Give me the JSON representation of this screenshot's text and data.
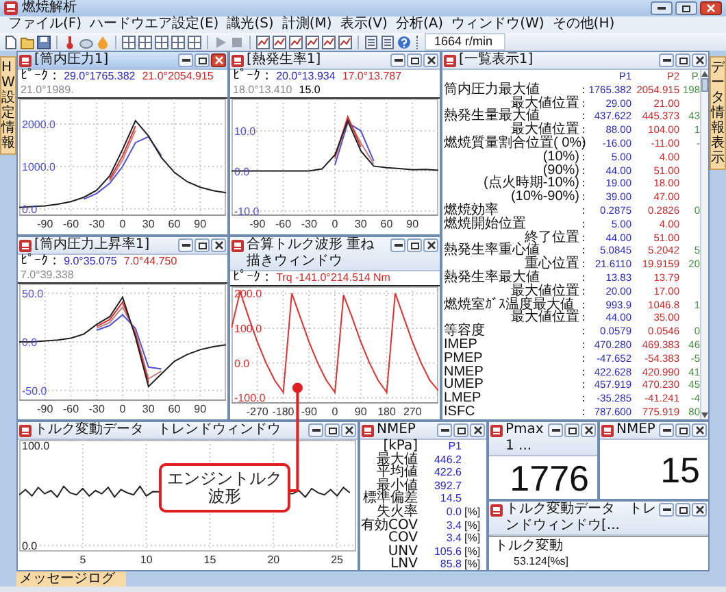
{
  "window": {
    "title": "燃焼解析"
  },
  "menu": [
    "ファイル(F)",
    "ハードウエア設定(E)",
    "識光(S)",
    "計測(M)",
    "表示(V)",
    "分析(A)",
    "ウィンドウ(W)",
    "その他(H)"
  ],
  "toolbar": {
    "rpm": "1664 r/min"
  },
  "side_tabs": {
    "left": "HW設定情報",
    "right": "データ情報表示"
  },
  "chart_windows": [
    {
      "title": "[筒内圧力1]",
      "active": true,
      "readout": {
        "label": "ﾋﾟｰｸ :",
        "values": [
          {
            "angle": "29.0°",
            "value": "1765.382",
            "color": "#2828c8"
          },
          {
            "angle": "21.0°",
            "value": "2054.915",
            "color": "#d02828"
          },
          {
            "angle": "21.0°",
            "value": "1989.",
            "color": "#8a8a8a"
          }
        ]
      },
      "chart_data": {
        "type": "line",
        "grid": true,
        "x": [
          -120,
          -105,
          -90,
          -75,
          -60,
          -45,
          -30,
          -15,
          0,
          15,
          30,
          45,
          60,
          75,
          90,
          105,
          120
        ],
        "xlim": [
          -120,
          120
        ],
        "ylim": [
          -150,
          2600
        ],
        "xticks": [
          -90,
          -60,
          -30,
          0,
          30,
          60,
          90
        ],
        "yticks": [
          {
            "value": 0,
            "label": "0.0"
          },
          {
            "value": 1000,
            "label": "1000.0"
          },
          {
            "value": 2000,
            "label": "2000.0"
          }
        ],
        "series": [
          {
            "color": "#5050d8",
            "values": [
              null,
              null,
              null,
              null,
              null,
              230,
              360,
              600,
              1000,
              1560,
              1700,
              1250,
              null,
              null,
              null,
              null,
              null
            ]
          },
          {
            "color": "#c08080",
            "values": [
              null,
              null,
              null,
              null,
              null,
              null,
              null,
              650,
              1150,
              1850,
              null,
              null,
              null,
              null,
              null,
              null,
              null
            ]
          },
          {
            "color": "#d83030",
            "values": [
              null,
              null,
              null,
              null,
              null,
              null,
              null,
              700,
              1250,
              1950,
              null,
              null,
              null,
              null,
              null,
              null,
              null
            ]
          },
          {
            "color": "#202020",
            "values": [
              30,
              50,
              70,
              110,
              170,
              270,
              440,
              780,
              1400,
              2080,
              1720,
              1210,
              860,
              640,
              510,
              430,
              380
            ]
          }
        ]
      }
    },
    {
      "title": "[熱発生率1]",
      "active": false,
      "readout": {
        "label": "ﾋﾟｰｸ :",
        "values": [
          {
            "angle": "20.0°",
            "value": "13.934",
            "color": "#2828c8"
          },
          {
            "angle": "17.0°",
            "value": "13.787",
            "color": "#d02828"
          },
          {
            "angle": "18.0°",
            "value": "13.410",
            "color": "#8a8a8a"
          },
          {
            "angle": "15.0",
            "color": "#000000"
          }
        ]
      },
      "chart_data": {
        "type": "line",
        "grid": true,
        "x": [
          -120,
          -105,
          -90,
          -75,
          -60,
          -45,
          -30,
          -15,
          0,
          15,
          30,
          45,
          60,
          75,
          90,
          105,
          120
        ],
        "xlim": [
          -120,
          120
        ],
        "ylim": [
          -11,
          18
        ],
        "xticks": [
          -90,
          -60,
          -30,
          0,
          30,
          60,
          90
        ],
        "yticks": [
          {
            "value": -10,
            "label": "-10.0"
          },
          {
            "value": 0,
            "label": "0.0"
          },
          {
            "value": 10,
            "label": "10.0"
          }
        ],
        "series": [
          {
            "color": "#5050d8",
            "values": [
              null,
              null,
              null,
              null,
              null,
              null,
              null,
              null,
              1.5,
              12,
              10,
              2.5,
              null,
              null,
              null,
              null,
              null
            ]
          },
          {
            "color": "#c08080",
            "values": [
              null,
              null,
              null,
              null,
              null,
              null,
              null,
              null,
              3,
              13,
              7,
              1.8,
              null,
              null,
              null,
              null,
              null
            ]
          },
          {
            "color": "#d83030",
            "values": [
              null,
              null,
              null,
              null,
              null,
              null,
              null,
              null,
              3.5,
              13.5,
              6,
              null,
              null,
              null,
              null,
              null,
              null
            ]
          },
          {
            "color": "#202020",
            "values": [
              0,
              0,
              0,
              0,
              0,
              0,
              0,
              0.5,
              4,
              12.5,
              5,
              1.2,
              0.8,
              0.6,
              0.3,
              0.4,
              0.2
            ]
          }
        ]
      }
    },
    {
      "title": "[筒内圧力上昇率1]",
      "active": false,
      "readout": {
        "label": "ﾋﾟｰｸ :",
        "values": [
          {
            "angle": "9.0°",
            "value": "35.075",
            "color": "#2828c8"
          },
          {
            "angle": "7.0°",
            "value": "44.750",
            "color": "#d02828"
          },
          {
            "angle": "7.0°",
            "value": "39.338",
            "color": "#8a8a8a"
          }
        ]
      },
      "chart_data": {
        "type": "line",
        "grid": true,
        "x": [
          -120,
          -105,
          -90,
          -75,
          -60,
          -45,
          -30,
          -15,
          0,
          15,
          30,
          45,
          60,
          75,
          90,
          105,
          120
        ],
        "xlim": [
          -120,
          120
        ],
        "ylim": [
          -60,
          60
        ],
        "xticks": [
          -90,
          -60,
          -30,
          0,
          30,
          60,
          90
        ],
        "yticks": [
          {
            "value": -50,
            "label": "-50.0"
          },
          {
            "value": 0,
            "label": "0.0"
          },
          {
            "value": 50,
            "label": "50.0"
          }
        ],
        "series": [
          {
            "color": "#5050d8",
            "values": [
              null,
              null,
              null,
              null,
              null,
              null,
              12,
              17,
              28,
              14,
              -26,
              -28,
              null,
              null,
              null,
              null,
              null
            ]
          },
          {
            "color": "#c08080",
            "values": [
              null,
              null,
              null,
              null,
              null,
              null,
              14,
              20,
              36,
              10,
              -38,
              -30,
              null,
              null,
              null,
              null,
              null
            ]
          },
          {
            "color": "#d83030",
            "values": [
              null,
              null,
              null,
              null,
              null,
              null,
              16,
              23,
              41,
              8,
              -42,
              null,
              null,
              null,
              null,
              null,
              null
            ]
          },
          {
            "color": "#202020",
            "values": [
              0,
              0,
              1,
              2,
              4,
              8,
              18,
              26,
              46,
              5,
              -46,
              -33,
              -20,
              -13,
              -8,
              -5,
              -3
            ]
          }
        ]
      }
    },
    {
      "title": "合算トルク波形 重ね描きウィンドウ",
      "active": false,
      "readout": {
        "label": "ﾋﾟｰｸ :",
        "values": [
          {
            "angle": "Trq -141.0°",
            "value": "214.514 Nm",
            "color": "#d02828"
          }
        ]
      },
      "chart_data": {
        "type": "line",
        "grid": true,
        "x": [
          -360,
          -330,
          -300,
          -270,
          -240,
          -210,
          -180,
          -150,
          -120,
          -90,
          -60,
          -30,
          0,
          30,
          60,
          90,
          120,
          150,
          180,
          210,
          240,
          270,
          300,
          330,
          360
        ],
        "xlim": [
          -360,
          360
        ],
        "ylim": [
          -115,
          220
        ],
        "xticks": [
          -270,
          -180,
          -90,
          0,
          90,
          180,
          270
        ],
        "yticks": [
          {
            "value": -100,
            "label": "-100.0"
          },
          {
            "value": 0,
            "label": "0.0"
          },
          {
            "value": 100,
            "label": "100.0"
          },
          {
            "value": 200,
            "label": "200.0"
          }
        ],
        "series": [
          {
            "color": "#e03030",
            "values": [
              100,
              205,
              130,
              60,
              0,
              -50,
              -85,
              200,
              130,
              60,
              0,
              -50,
              -85,
              195,
              130,
              60,
              0,
              -50,
              -85,
              200,
              130,
              60,
              0,
              -50,
              -80
            ]
          }
        ]
      }
    }
  ],
  "summary_window": {
    "title": "[一覧表示1]",
    "active": false,
    "columns": [
      {
        "label": "P1",
        "color": "#2828c8"
      },
      {
        "label": "P2",
        "color": "#d02828"
      },
      {
        "label": "P.",
        "color": "#409040"
      }
    ],
    "rows": [
      {
        "label": "筒内圧力最大値",
        "kind": "main",
        "sep": ":",
        "values": [
          "1765.382",
          "2054.915",
          "198"
        ]
      },
      {
        "label": "最大値位置",
        "kind": "sub",
        "sep": ":",
        "values": [
          "29.00",
          "21.00"
        ]
      },
      {
        "label": "熱発生量最大値",
        "kind": "main",
        "sep": ":",
        "values": [
          "437.622",
          "445.373",
          "43"
        ]
      },
      {
        "label": "最大値位置",
        "kind": "sub",
        "sep": ":",
        "values": [
          "88.00",
          "104.00",
          "1"
        ]
      },
      {
        "label": "燃焼質量割合位置( 0%)",
        "kind": "main",
        "sep": ":",
        "values": [
          "-16.00",
          "-11.00",
          "-"
        ]
      },
      {
        "label": "(10%)",
        "kind": "sub",
        "sep": ":",
        "values": [
          "5.00",
          "4.00"
        ]
      },
      {
        "label": "(90%)",
        "kind": "sub",
        "sep": ":",
        "values": [
          "44.00",
          "51.00"
        ]
      },
      {
        "label": "(点火時期-10%)",
        "kind": "sub",
        "sep": ":",
        "values": [
          "19.00",
          "18.00"
        ]
      },
      {
        "label": "(10%-90%)",
        "kind": "sub",
        "sep": ":",
        "values": [
          "39.00",
          "47.00"
        ]
      },
      {
        "label": "燃焼効率",
        "kind": "main",
        "sep": ":",
        "values": [
          "0.2875",
          "0.2826",
          "0"
        ]
      },
      {
        "label": "燃焼開始位置",
        "kind": "main",
        "sep": ":",
        "values": [
          "5.00",
          "4.00"
        ]
      },
      {
        "label": "終了位置",
        "kind": "sub",
        "sep": ":",
        "values": [
          "44.00",
          "51.00"
        ]
      },
      {
        "label": "熱発生率重心値",
        "kind": "main",
        "sep": ":",
        "values": [
          "5.0845",
          "5.2042",
          "5"
        ]
      },
      {
        "label": "重心位置",
        "kind": "sub",
        "sep": ":",
        "values": [
          "21.6110",
          "19.9159",
          "20"
        ]
      },
      {
        "label": "熱発生率最大値",
        "kind": "main",
        "sep": ":",
        "values": [
          "13.83",
          "13.79"
        ]
      },
      {
        "label": "最大値位置",
        "kind": "sub",
        "sep": ":",
        "values": [
          "20.00",
          "17.00"
        ]
      },
      {
        "label": "燃焼室ｶﾞｽ温度最大値",
        "kind": "main",
        "sep": ":",
        "values": [
          "993.9",
          "1046.8",
          "1"
        ]
      },
      {
        "label": "最大値位置",
        "kind": "sub",
        "sep": ":",
        "values": [
          "44.00",
          "35.00"
        ]
      },
      {
        "label": "等容度",
        "kind": "main",
        "sep": ":",
        "values": [
          "0.0579",
          "0.0546",
          "0"
        ]
      },
      {
        "label": "IMEP",
        "kind": "main",
        "sep": ":",
        "values": [
          "470.280",
          "469.383",
          "46"
        ]
      },
      {
        "label": "PMEP",
        "kind": "main",
        "sep": ":",
        "values": [
          "-47.652",
          "-54.383",
          "-5"
        ]
      },
      {
        "label": "NMEP",
        "kind": "main",
        "sep": ":",
        "values": [
          "422.628",
          "420.990",
          "41"
        ]
      },
      {
        "label": "UMEP",
        "kind": "main",
        "sep": ":",
        "values": [
          "457.919",
          "470.230",
          "45"
        ]
      },
      {
        "label": "LMEP",
        "kind": "main",
        "sep": ":",
        "values": [
          "-35.285",
          "-41.241",
          "-4"
        ]
      },
      {
        "label": "ISFC",
        "kind": "main",
        "sep": ":",
        "values": [
          "787.600",
          "775.919",
          "80"
        ]
      }
    ]
  },
  "trend_window": {
    "title": "トルク変動データ　トレンドウィンドウ",
    "active": false,
    "chart_data": {
      "type": "line",
      "grid": true,
      "x": [
        0,
        0.5,
        1,
        1.5,
        2,
        2.5,
        3,
        3.5,
        4,
        4.5,
        5,
        5.5,
        6,
        6.5,
        7,
        7.5,
        8,
        8.5,
        9,
        9.5,
        10,
        10.5,
        21.5,
        22,
        22.5,
        23,
        23.5,
        24,
        24.5,
        25,
        25.5,
        26
      ],
      "xlim": [
        0,
        26.5
      ],
      "ylim": [
        -5,
        100
      ],
      "xticks": [
        5,
        10,
        15,
        20,
        25
      ],
      "yticks": [
        {
          "value": 0,
          "label": "0.0"
        },
        {
          "value": 100,
          "label": "100.0"
        }
      ],
      "series": [
        {
          "color": "#202020",
          "values": [
            48,
            53,
            47,
            55,
            49,
            52,
            46,
            56,
            50,
            48,
            54,
            47,
            52,
            49,
            55,
            46,
            53,
            50,
            48,
            56,
            47,
            51,
            49,
            52,
            46,
            54,
            50,
            48,
            53,
            47,
            55,
            50
          ]
        }
      ]
    }
  },
  "stats_window": {
    "title": "NMEP",
    "active": false,
    "header": [
      "[kPa]",
      "P1"
    ],
    "rows": [
      {
        "label": "最大値",
        "value": "446.2"
      },
      {
        "label": "平均値",
        "value": "422.6"
      },
      {
        "label": "最小値",
        "value": "392.7"
      },
      {
        "label": "標準偏差",
        "value": "14.5"
      },
      {
        "label": "失火率",
        "value": "0.0",
        "unit": "[%]"
      },
      {
        "label": "有効COV",
        "value": "3.4",
        "unit": "[%]"
      },
      {
        "label": "COV",
        "value": "3.4",
        "unit": "[%]"
      },
      {
        "label": "UNV",
        "value": "105.6",
        "unit": "[%]"
      },
      {
        "label": "LNV",
        "value": "85.8",
        "unit": "[%]"
      }
    ]
  },
  "value_windows": [
    {
      "title": "Pmax1 ...",
      "active": false,
      "value": "1776"
    },
    {
      "title": "NMEP",
      "active": false,
      "value": "15"
    }
  ],
  "trend_value_window": {
    "title": "トルク変動データ　トレンドウィンドウ[...",
    "active": false,
    "label": "トルク変動",
    "value": "53.124[%s]"
  },
  "message_tab": {
    "label": "メッセージログ",
    "selected": true
  },
  "callout": {
    "text": "エンジントルク波形"
  }
}
